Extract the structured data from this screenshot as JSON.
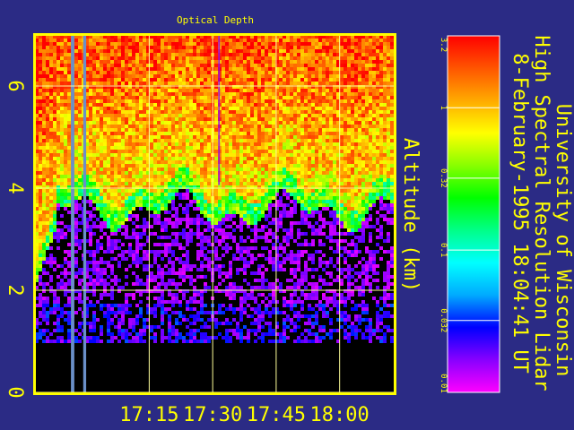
{
  "chart_data": {
    "type": "heatmap",
    "title": "Optical Depth",
    "ylabel": "Altitude (km)",
    "xlabel": "",
    "x_ticks": [
      "17:15",
      "17:30",
      "17:45",
      "18:00"
    ],
    "x_tick_values_min": [
      1035,
      1050,
      1065,
      1080
    ],
    "xlim_min": [
      1008,
      1093
    ],
    "y_ticks": [
      0,
      2,
      4,
      6
    ],
    "ylim": [
      0,
      7
    ],
    "grid": true,
    "colorbar": {
      "scale": "log",
      "range": [
        0.01,
        3.2
      ],
      "tick_labels": [
        "3.2",
        "1",
        "0.32",
        "0.1",
        "0.032",
        "0.01"
      ],
      "tick_values": [
        3.2,
        1,
        0.32,
        0.1,
        0.032,
        0.01
      ],
      "colors": [
        "#ff00ff",
        "#8800ff",
        "#0000ff",
        "#00aaff",
        "#00ffff",
        "#00ff88",
        "#00ff00",
        "#88ff00",
        "#ffff00",
        "#ffaa00",
        "#ff5500",
        "#ff0000"
      ]
    },
    "colors": {
      "background": "#2b2b85",
      "frame": "#ffff00",
      "grid": "#ffff99",
      "text": "#ffff00",
      "ground": "#000000",
      "dropout": "#6a8fc8"
    }
  },
  "caption": {
    "line1": "University of Wisconsin",
    "line2": "High Spectral Resolution Lidar",
    "line3": "8-February-1995 18:04:41 UT"
  }
}
